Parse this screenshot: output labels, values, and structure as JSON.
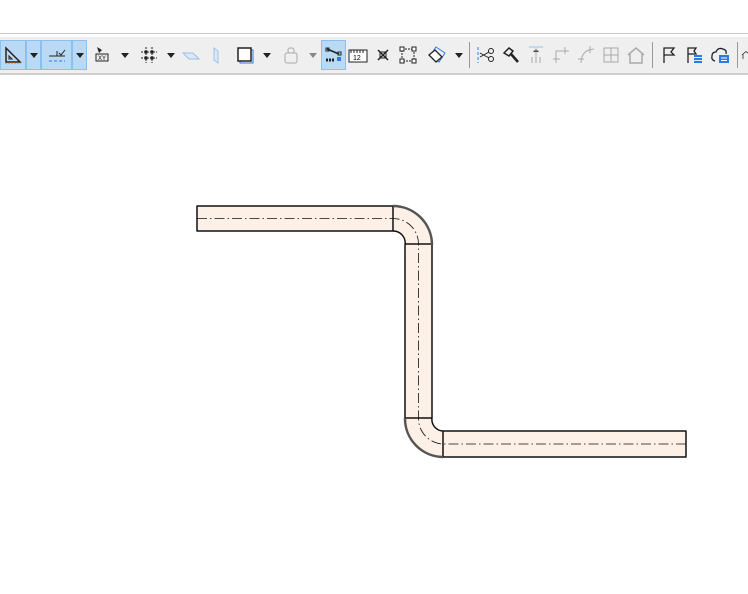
{
  "toolbar": {
    "items": [
      {
        "icon": "angle-ruler-icon",
        "active": true,
        "disabled": false,
        "dropdown": true
      },
      {
        "icon": "snap-guide-icon",
        "active": true,
        "disabled": false,
        "dropdown": true
      },
      {
        "icon": "xy-coordinates-icon",
        "active": false,
        "disabled": false,
        "dropdown": true
      },
      {
        "icon": "grid-snap-icon",
        "active": false,
        "disabled": false,
        "dropdown": true
      },
      {
        "icon": "plane-horizontal-icon",
        "active": false,
        "disabled": true,
        "dropdown": false
      },
      {
        "icon": "plane-vertical-icon",
        "active": false,
        "disabled": true,
        "dropdown": false
      },
      {
        "icon": "layers-square-icon",
        "active": false,
        "disabled": false,
        "dropdown": true
      },
      {
        "icon": "weight-lock-icon",
        "active": false,
        "disabled": true,
        "dropdown": true
      },
      {
        "icon": "magic-wand-select-icon",
        "active": true,
        "disabled": false,
        "dropdown": false
      },
      {
        "icon": "measure-ruler-icon",
        "active": false,
        "disabled": false,
        "dropdown": false
      },
      {
        "icon": "intersection-icon",
        "active": false,
        "disabled": false,
        "dropdown": false
      },
      {
        "icon": "bounding-box-icon",
        "active": false,
        "disabled": false,
        "dropdown": false
      },
      {
        "icon": "3d-view-icon",
        "active": false,
        "disabled": false,
        "dropdown": true
      },
      {
        "icon": "scissors-split-icon",
        "active": false,
        "disabled": false,
        "dropdown": false
      },
      {
        "icon": "hammer-adjust-icon",
        "active": false,
        "disabled": false,
        "dropdown": false
      },
      {
        "icon": "elevate-icon",
        "active": false,
        "disabled": true,
        "dropdown": false
      },
      {
        "icon": "corner-icon",
        "active": false,
        "disabled": true,
        "dropdown": false
      },
      {
        "icon": "fillet-icon",
        "active": false,
        "disabled": true,
        "dropdown": false
      },
      {
        "icon": "offset-icon",
        "active": false,
        "disabled": true,
        "dropdown": false
      },
      {
        "icon": "roof-icon",
        "active": false,
        "disabled": true,
        "dropdown": false
      },
      {
        "icon": "flag-icon",
        "active": false,
        "disabled": false,
        "dropdown": false
      },
      {
        "icon": "flag-list-icon",
        "active": false,
        "disabled": false,
        "dropdown": false
      },
      {
        "icon": "cloud-list-icon",
        "active": false,
        "disabled": false,
        "dropdown": false
      }
    ]
  },
  "drawing": {
    "element": "pipe",
    "fill_color": "#fdf0e6",
    "stroke_color": "#111111",
    "centerline": "dash-dot"
  }
}
